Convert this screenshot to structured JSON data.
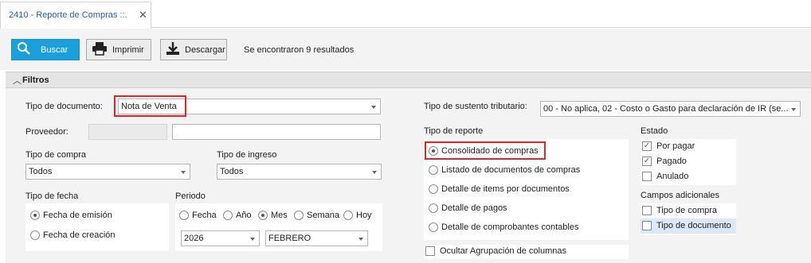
{
  "tab": {
    "title": "2410 - Reporte de Compras ::.",
    "close": "✕"
  },
  "toolbar": {
    "search_label": "Buscar",
    "print_label": "Imprimir",
    "download_label": "Descargar",
    "results_text": "Se encontraron 9 resultados"
  },
  "filters": {
    "group_title": "Filtros",
    "tipo_documento": {
      "label": "Tipo de documento:",
      "value": "Nota de Venta"
    },
    "proveedor": {
      "label": "Proveedor:",
      "code": "",
      "name": ""
    },
    "tipo_compra": {
      "label": "Tipo de compra",
      "value": "Todos"
    },
    "tipo_ingreso": {
      "label": "Tipo de ingreso",
      "value": "Todos"
    },
    "tipo_fecha": {
      "label": "Tipo de fecha",
      "options": [
        "Fecha de emisión",
        "Fecha de creación"
      ],
      "selected": "Fecha de emisión"
    },
    "periodo": {
      "label": "Periodo",
      "options": [
        "Fecha",
        "Año",
        "Mes",
        "Semana",
        "Hoy"
      ],
      "selected": "Mes",
      "year": "2026",
      "month": "FEBRERO"
    },
    "sustento": {
      "label": "Tipo de sustento tributario:",
      "value": "00 - No aplica, 02 - Costo o Gasto para declaración de IR (se..."
    },
    "tipo_reporte": {
      "label": "Tipo de reporte",
      "options": [
        "Consolidado de compras",
        "Listado de documentos de compras",
        "Detalle de items por documentos",
        "Detalle de pagos",
        "Detalle de comprobantes contables"
      ],
      "selected": "Consolidado de compras",
      "ocultar_label": "Ocultar Agrupación de columnas"
    },
    "estado": {
      "label": "Estado",
      "items": [
        {
          "label": "Por pagar",
          "checked": true
        },
        {
          "label": "Pagado",
          "checked": true
        },
        {
          "label": "Anulado",
          "checked": false
        }
      ]
    },
    "campos": {
      "label": "Campos adicionales",
      "items": [
        {
          "label": "Tipo de compra",
          "checked": false
        },
        {
          "label": "Tipo de documento",
          "checked": false
        }
      ]
    }
  },
  "colors": {
    "accent": "#1aa1dc",
    "highlight": "#e0242b",
    "tab_text": "#2a5ea8"
  }
}
